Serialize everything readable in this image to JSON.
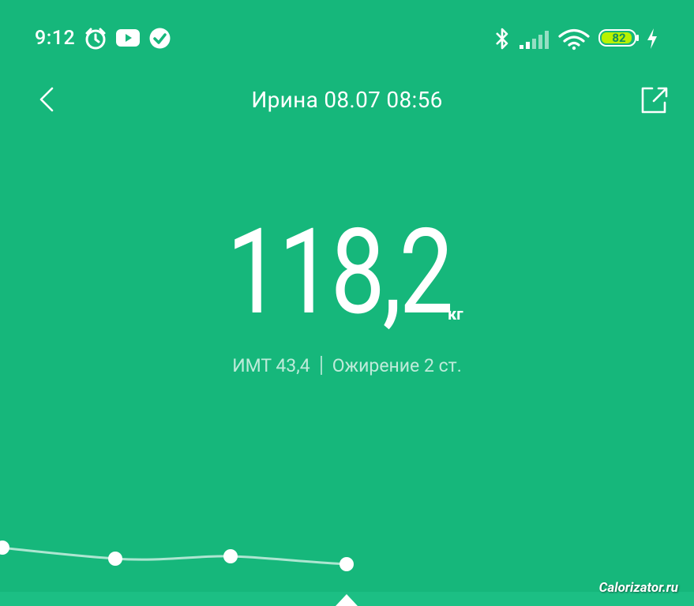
{
  "status_bar": {
    "time": "9:12",
    "battery_percent": "82",
    "icons": [
      "alarm-icon",
      "youtube-icon",
      "check-circle-icon",
      "bluetooth-icon",
      "signal-icon",
      "wifi-icon",
      "battery-icon",
      "charging-icon"
    ]
  },
  "header": {
    "title": "Ирина 08.07 08:56",
    "back_icon": "chevron-left-icon",
    "share_icon": "share-icon"
  },
  "measurement": {
    "weight": "118,2",
    "unit": "кг",
    "bmi_label": "ИМТ 43,4",
    "category": "Ожирение 2 ст."
  },
  "chart_data": {
    "type": "line",
    "note_points": 4,
    "selected_index": 3
  },
  "watermark": "Calorizator.ru",
  "colors": {
    "background": "#16b77b",
    "text": "#ffffff"
  }
}
